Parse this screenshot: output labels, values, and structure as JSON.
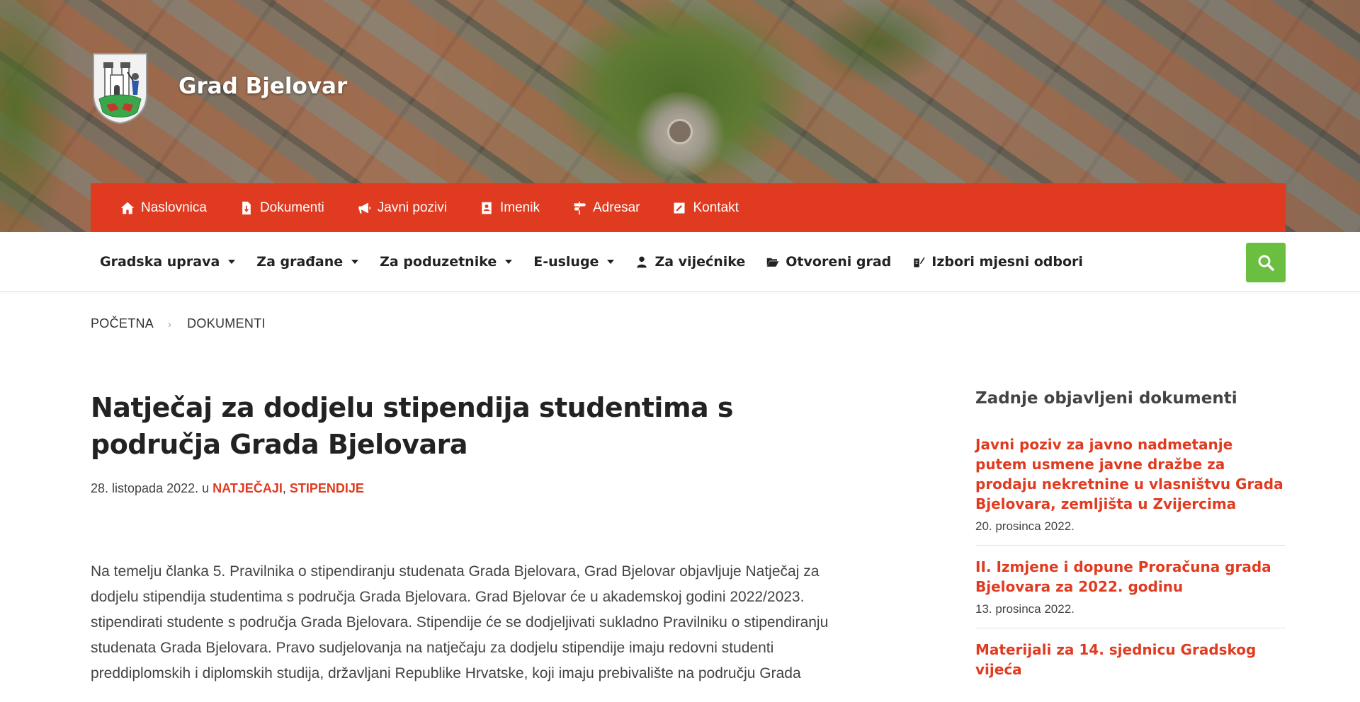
{
  "site": {
    "title": "Grad Bjelovar"
  },
  "top_nav": [
    {
      "label": "Naslovnica",
      "icon": "home-icon"
    },
    {
      "label": "Dokumenti",
      "icon": "document-download-icon"
    },
    {
      "label": "Javni pozivi",
      "icon": "megaphone-icon"
    },
    {
      "label": "Imenik",
      "icon": "address-book-icon"
    },
    {
      "label": "Adresar",
      "icon": "signpost-icon"
    },
    {
      "label": "Kontakt",
      "icon": "edit-square-icon"
    }
  ],
  "main_nav": [
    {
      "label": "Gradska uprava",
      "dropdown": true
    },
    {
      "label": "Za građane",
      "dropdown": true
    },
    {
      "label": "Za poduzetnike",
      "dropdown": true
    },
    {
      "label": "E-usluge",
      "dropdown": true
    },
    {
      "label": "Za vijećnike",
      "icon": "user-icon"
    },
    {
      "label": "Otvoreni grad",
      "icon": "folder-open-icon"
    },
    {
      "label": "Izbori mjesni odbori",
      "icon": "ballot-icon"
    }
  ],
  "search": {
    "icon": "search-icon",
    "color": "#6abf40"
  },
  "breadcrumb": {
    "home": "POČETNA",
    "separator": "›",
    "current": "DOKUMENTI"
  },
  "article": {
    "title": "Natječaj za dodjelu stipendija studentima s područja Grada Bjelovara",
    "date": "28. listopada 2022.",
    "in": " u ",
    "categories": [
      "NATJEČAJI",
      "STIPENDIJE"
    ],
    "category_sep": ", ",
    "body": "Na temelju članka 5. Pravilnika o stipendiranju studenata Grada Bjelovara, Grad Bjelovar objavljuje Natječaj za dodjelu stipendija studentima s područja Grada Bjelovara. Grad Bjelovar će u akademskoj godini 2022/2023. stipendirati studente s područja Grada Bjelovara. Stipendije će se dodjeljivati sukladno Pravilniku o stipendiranju studenata Grada Bjelovara. Pravo sudjelovanja na natječaju za dodjelu stipendije imaju redovni studenti preddiplomskih i diplomskih studija, državljani Republike Hrvatske, koji imaju prebivalište na području Grada"
  },
  "sidebar": {
    "heading": "Zadnje objavljeni dokumenti",
    "documents": [
      {
        "title": "Javni poziv za javno nadmetanje putem usmene javne dražbe za prodaju nekretnine u vlasništvu Grada Bjelovara, zemljišta u Zvijercima",
        "date": "20. prosinca 2022."
      },
      {
        "title": "II. Izmjene i dopune Proračuna grada Bjelovara za 2022. godinu",
        "date": "13. prosinca 2022."
      },
      {
        "title": "Materijali za 14. sjednicu Gradskog vijeća",
        "date": ""
      }
    ]
  },
  "colors": {
    "accent": "#e03b20",
    "search": "#6abf40"
  }
}
